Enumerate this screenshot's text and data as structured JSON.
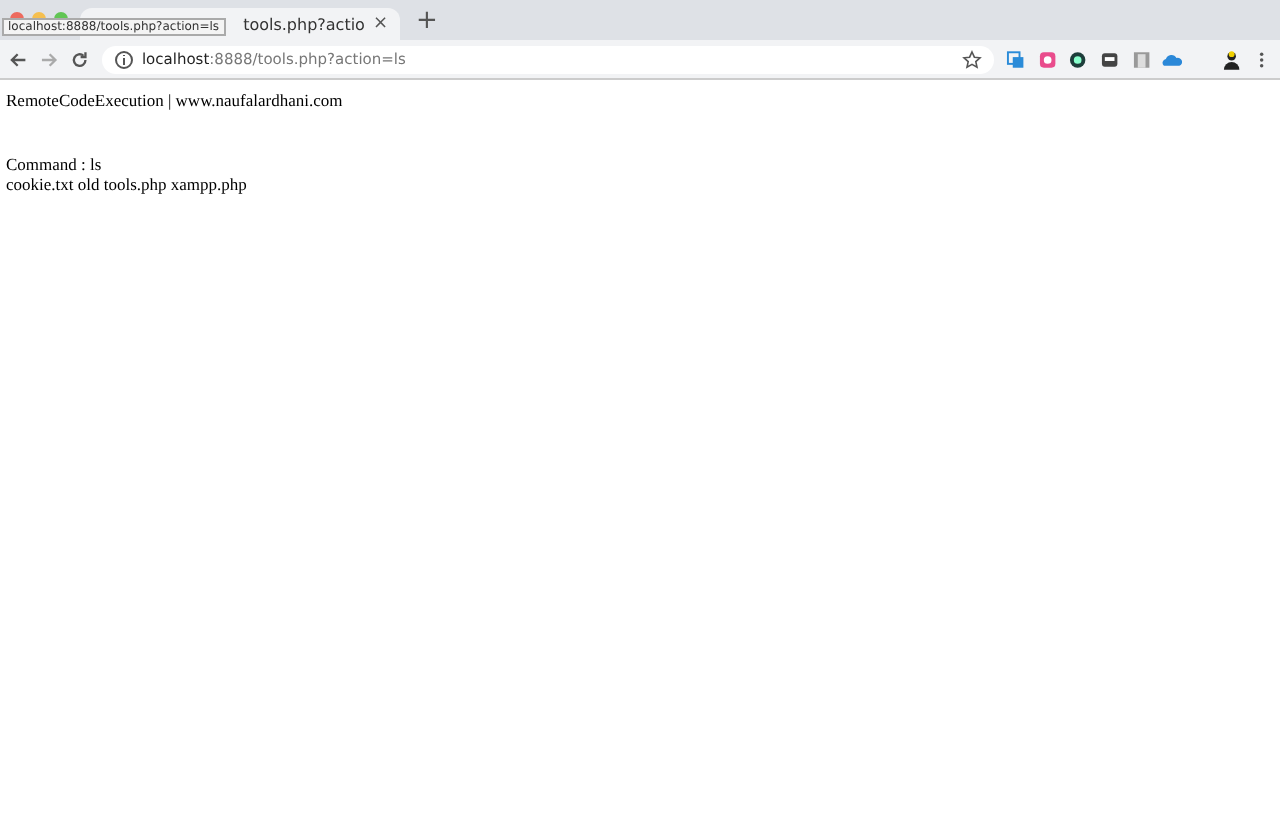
{
  "tab": {
    "title": "tools.php?actio",
    "close": "×"
  },
  "new_tab": "+",
  "tooltip": "localhost:8888/tools.php?action=ls",
  "address_bar": {
    "host": "localhost",
    "rest": ":8888/tools.php?action=ls"
  },
  "page": {
    "heading": "RemoteCodeExecution | www.naufalardhani.com",
    "command": "Command : ls",
    "output": "cookie.txt old tools.php xampp.php"
  }
}
